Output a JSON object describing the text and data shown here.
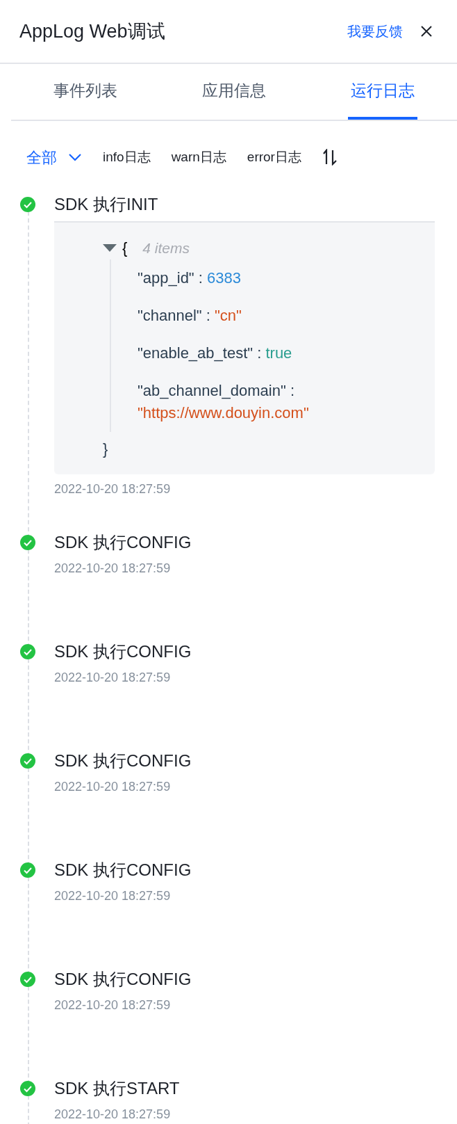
{
  "header": {
    "title": "AppLog Web调试",
    "feedback_link": "我要反馈"
  },
  "tabs": [
    {
      "label": "事件列表",
      "selected": false
    },
    {
      "label": "应用信息",
      "selected": false
    },
    {
      "label": "运行日志",
      "selected": true
    }
  ],
  "filters": [
    {
      "label": "全部",
      "selected": true,
      "kind": "dropdown"
    },
    {
      "label": "info日志",
      "selected": false,
      "kind": "plain"
    },
    {
      "label": "warn日志",
      "selected": false,
      "kind": "plain"
    },
    {
      "label": "error日志",
      "selected": false,
      "kind": "plain"
    }
  ],
  "logs": [
    {
      "title": "SDK 执行INIT",
      "time": "2022-10-20 18:27:59",
      "ok": true,
      "kind": "json",
      "json": {
        "expanded": true,
        "open_brace": "{",
        "close_brace": "}",
        "count": "4 items",
        "entries": [
          {
            "key": "\"app_id\" :",
            "value": "6383",
            "kind": "number"
          },
          {
            "key": "\"channel\" :",
            "value": "\"cn\"",
            "kind": "string"
          },
          {
            "key": "\"enable_ab_test\" :",
            "value": "true",
            "kind": "boolean"
          },
          {
            "key": "\"ab_channel_domain\" :",
            "value": "\"https://www.douyin.com\"",
            "kind": "string"
          }
        ]
      }
    },
    {
      "title": "SDK 执行CONFIG",
      "time": "2022-10-20 18:27:59",
      "ok": true,
      "kind": "plain"
    },
    {
      "title": "SDK 执行CONFIG",
      "time": "2022-10-20 18:27:59",
      "ok": true,
      "kind": "plain"
    },
    {
      "title": "SDK 执行CONFIG",
      "time": "2022-10-20 18:27:59",
      "ok": true,
      "kind": "plain"
    },
    {
      "title": "SDK 执行CONFIG",
      "time": "2022-10-20 18:27:59",
      "ok": true,
      "kind": "plain"
    },
    {
      "title": "SDK 执行CONFIG",
      "time": "2022-10-20 18:27:59",
      "ok": true,
      "kind": "plain"
    },
    {
      "title": "SDK 执行START",
      "time": "2022-10-20 18:27:59",
      "ok": true,
      "kind": "plain"
    }
  ]
}
